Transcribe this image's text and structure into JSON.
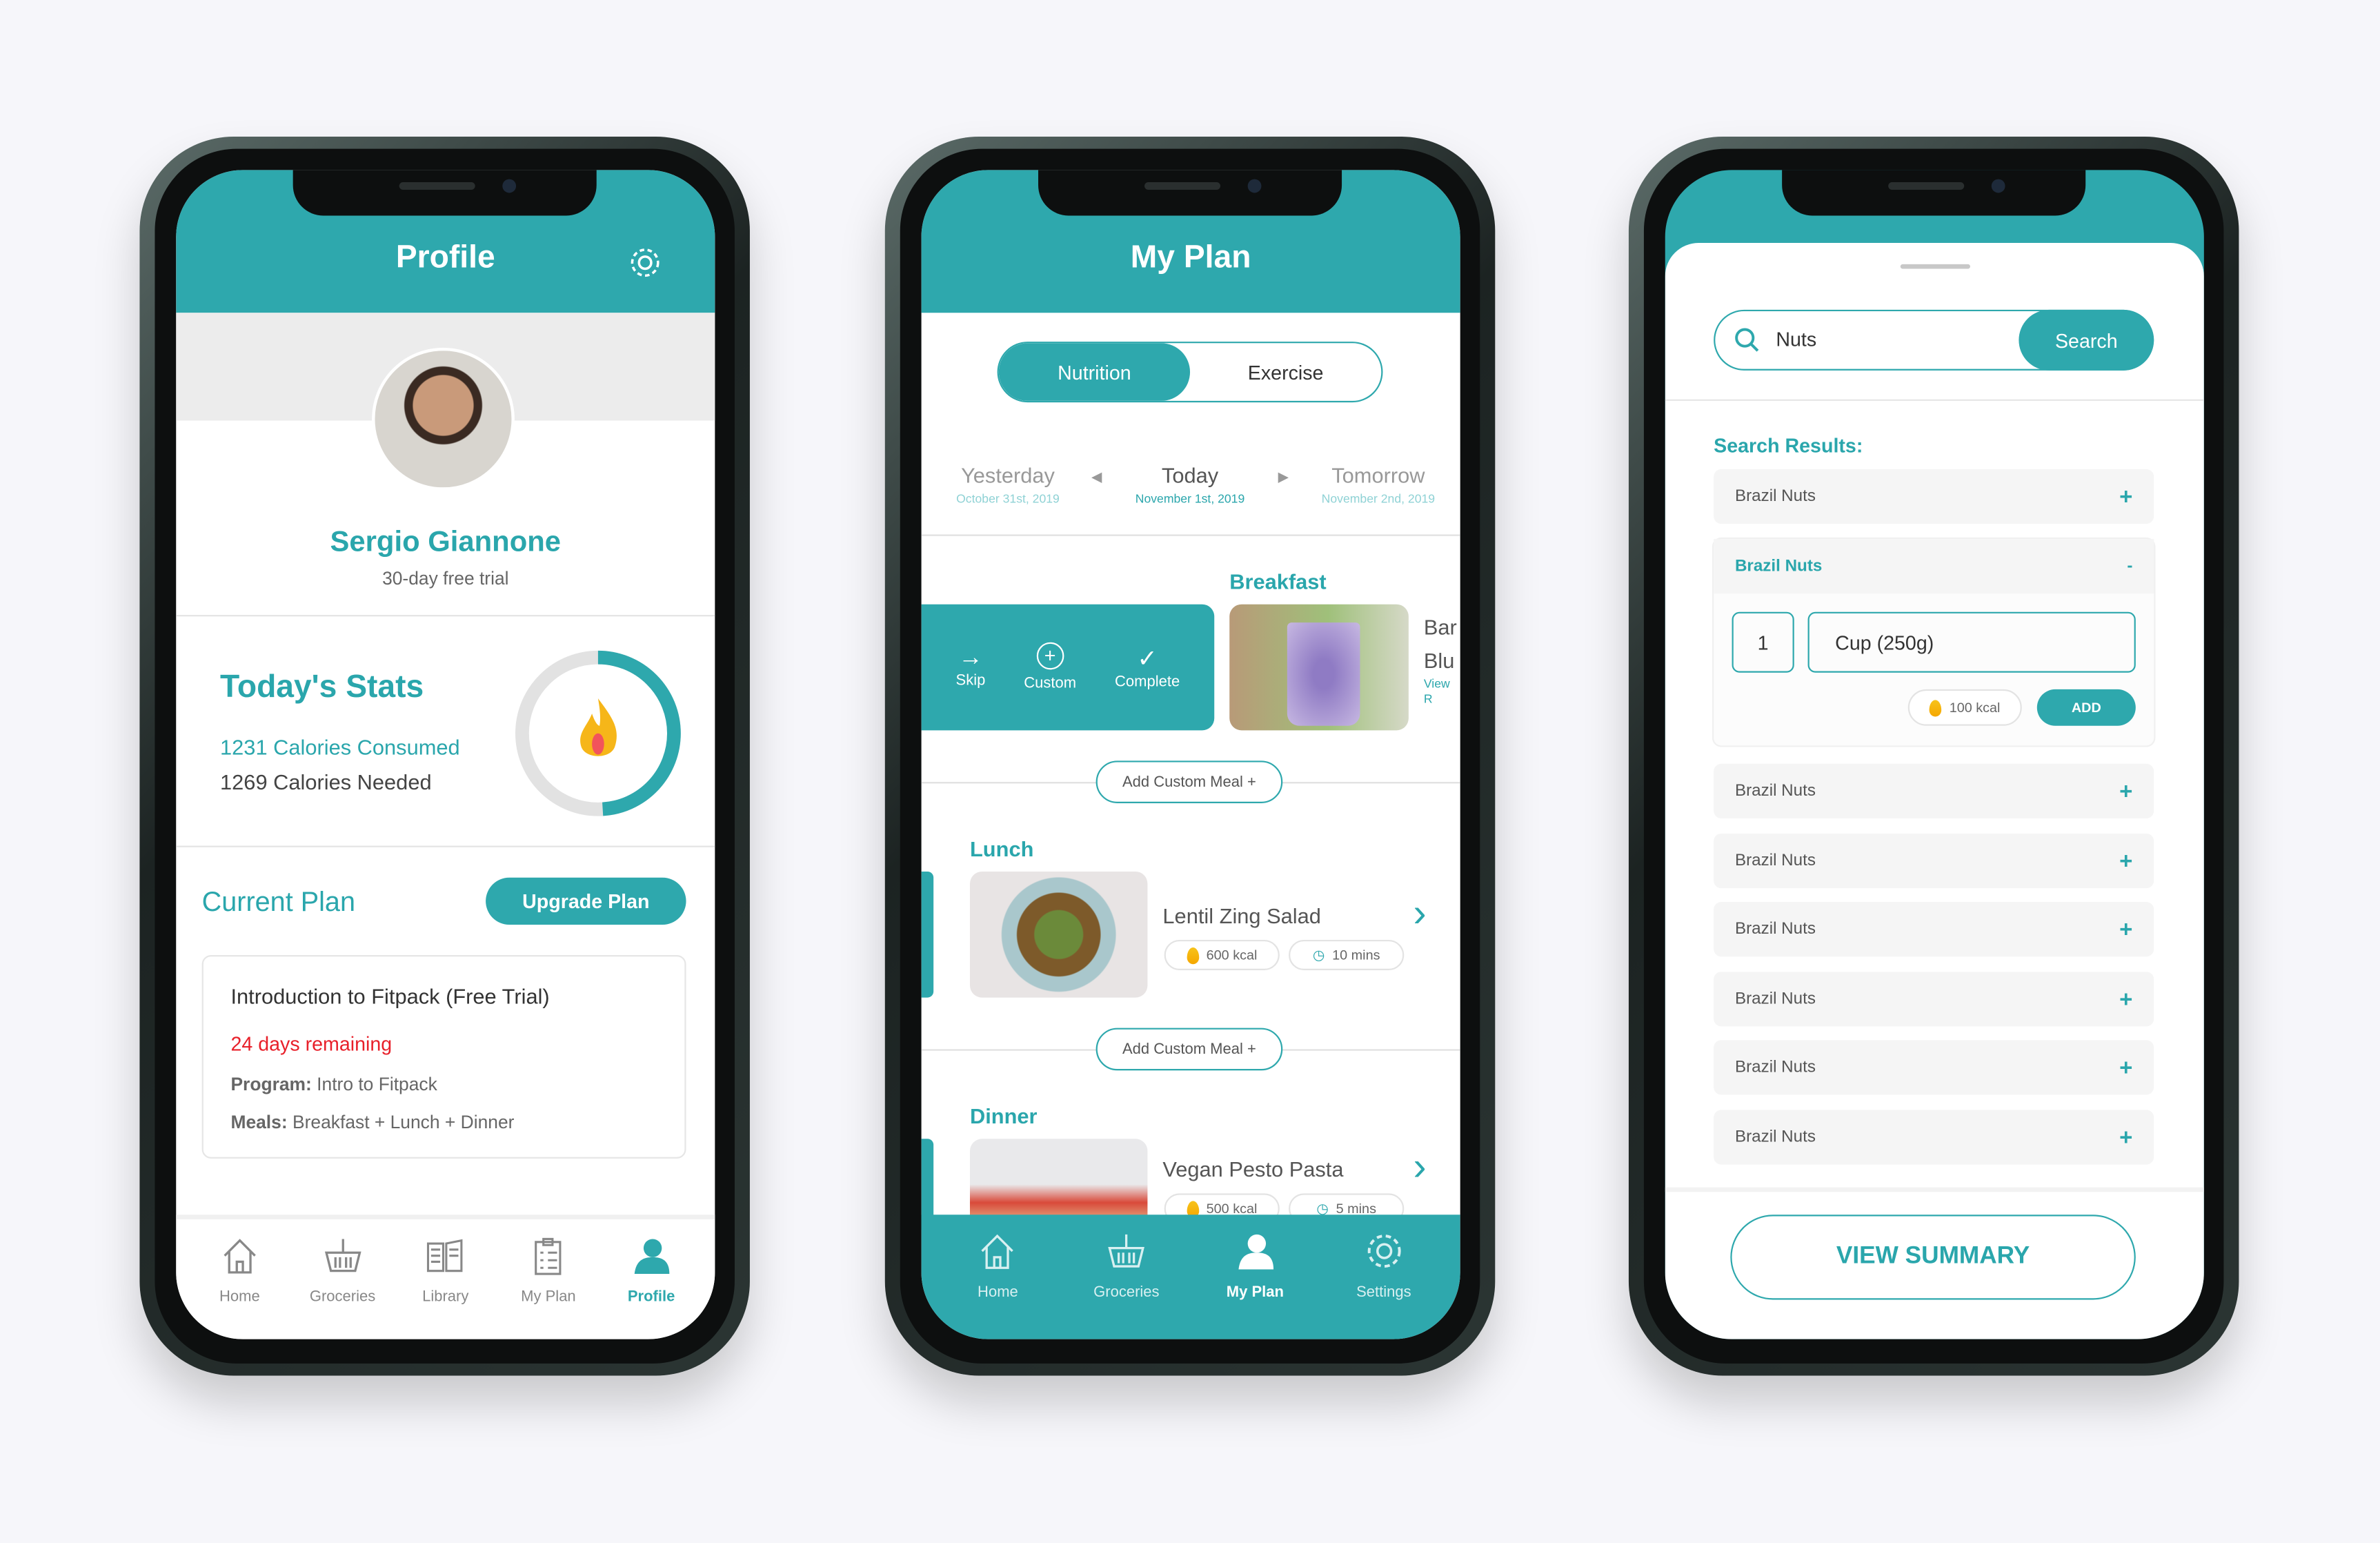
{
  "colors": {
    "teal": "#2ea8ad",
    "red": "#e8202a",
    "background": "#f6f6fa"
  },
  "profile": {
    "title": "Profile",
    "settings_icon": "gear-icon",
    "name": "Sergio Giannone",
    "subtitle": "30-day free trial",
    "stats": {
      "title": "Today's Stats",
      "consumed": "1231 Calories Consumed",
      "needed": "1269 Calories Needed",
      "progress_fraction": 0.49
    },
    "current_plan": {
      "title": "Current Plan",
      "upgrade_label": "Upgrade Plan",
      "card": {
        "name": "Introduction to Fitpack (Free Trial)",
        "remaining": "24 days remaining",
        "program_label": "Program:",
        "program_value": "Intro to Fitpack",
        "meals_label": "Meals:",
        "meals_value": "Breakfast + Lunch + Dinner"
      }
    },
    "nav": [
      {
        "label": "Home",
        "icon": "home-icon"
      },
      {
        "label": "Groceries",
        "icon": "basket-icon"
      },
      {
        "label": "Library",
        "icon": "book-icon"
      },
      {
        "label": "My Plan",
        "icon": "clipboard-icon"
      },
      {
        "label": "Profile",
        "icon": "user-icon",
        "active": true
      }
    ]
  },
  "plan": {
    "title": "My Plan",
    "tabs": [
      {
        "label": "Nutrition",
        "active": true
      },
      {
        "label": "Exercise",
        "active": false
      }
    ],
    "days": [
      {
        "label": "Yesterday",
        "date": "October 31st, 2019"
      },
      {
        "label": "Today",
        "date": "November 1st, 2019",
        "active": true
      },
      {
        "label": "Tomorrow",
        "date": "November 2nd, 2019"
      }
    ],
    "breakfast": {
      "label": "Breakfast",
      "actions": [
        "Skip",
        "Custom",
        "Complete"
      ],
      "title_partial_1": "Bar",
      "title_partial_2": "Blu",
      "view_partial": "View R"
    },
    "add_custom_meal": "Add Custom Meal +",
    "lunch": {
      "label": "Lunch",
      "name": "Lentil Zing Salad",
      "kcal": "600 kcal",
      "time": "10 mins"
    },
    "dinner": {
      "label": "Dinner",
      "name": "Vegan Pesto Pasta",
      "kcal": "500 kcal",
      "time": "5 mins"
    },
    "nav": [
      {
        "label": "Home",
        "icon": "home-icon"
      },
      {
        "label": "Groceries",
        "icon": "basket-icon"
      },
      {
        "label": "My Plan",
        "icon": "user-icon",
        "active": true
      },
      {
        "label": "Settings",
        "icon": "gear-icon"
      }
    ]
  },
  "search": {
    "query": "Nuts",
    "button": "Search",
    "results_title": "Search Results:",
    "results": [
      "Brazil Nuts",
      "Brazil Nuts",
      "Brazil Nuts",
      "Brazil Nuts",
      "Brazil Nuts",
      "Brazil Nuts",
      "Brazil Nuts",
      "Brazil Nuts"
    ],
    "expanded": {
      "name": "Brazil Nuts",
      "quantity": "1",
      "unit": "Cup (250g)",
      "kcal": "100 kcal",
      "add_label": "ADD",
      "collapse": "-"
    },
    "expand_symbol": "+",
    "summary_label": "VIEW SUMMARY"
  }
}
